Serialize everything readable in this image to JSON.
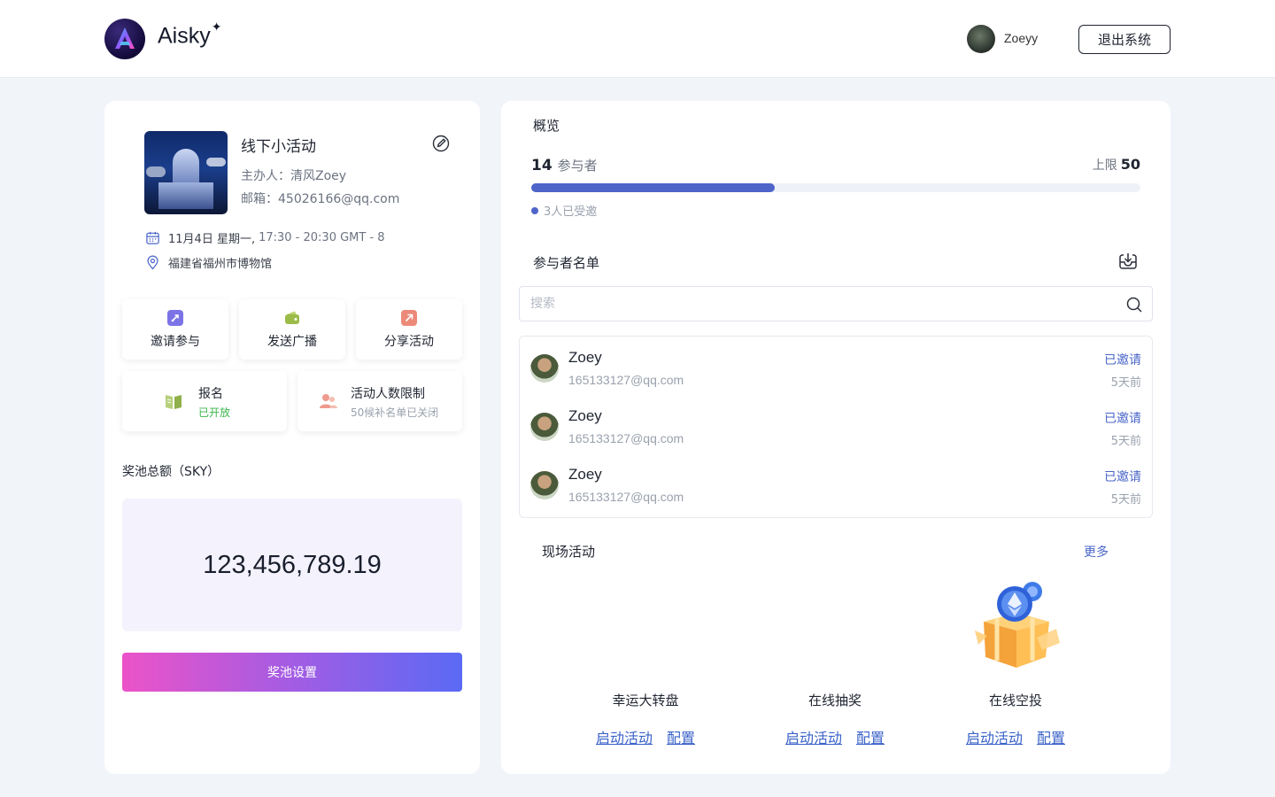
{
  "header": {
    "brand": "Aisky",
    "brand_mark": "✦",
    "user_name": "Zoeyy",
    "logout_label": "退出系统"
  },
  "event": {
    "title": "线下小活动",
    "host_label": "主办人：",
    "host": "清风Zoey",
    "email_label": "邮箱：",
    "email": "45026166@qq.com",
    "date": "11月4日  星期一,",
    "time": "17:30 - 20:30  GMT - 8",
    "location": "福建省福州市博物馆"
  },
  "actions": [
    {
      "label": "邀请参与",
      "icon": "invite-icon",
      "color": "#7b73e6"
    },
    {
      "label": "发送广播",
      "icon": "wallet-icon",
      "color": "#9cbc4a"
    },
    {
      "label": "分享活动",
      "icon": "share-arrow-icon",
      "color": "#ec8a7a"
    }
  ],
  "signup": {
    "title": "报名",
    "status": "已开放",
    "status_color": "#39b54a"
  },
  "limit_tile": {
    "title": "活动人数限制",
    "status": "50候补名单已关闭"
  },
  "pool": {
    "label": "奖池总额（SKY）",
    "value": "123,456,789.19",
    "button_label": "奖池设置"
  },
  "overview": {
    "title": "概览",
    "count": "14",
    "count_label": "参与者",
    "limit_label": "上限",
    "limit": "50",
    "progress": 0.4,
    "invited_note": "3人已受邀"
  },
  "attendees": {
    "title": "参与者名单",
    "search_placeholder": "搜索",
    "rows": [
      {
        "name": "Zoey",
        "email": "165133127@qq.com",
        "status": "已邀请",
        "time": "5天前"
      },
      {
        "name": "Zoey",
        "email": "165133127@qq.com",
        "status": "已邀请",
        "time": "5天前"
      },
      {
        "name": "Zoey",
        "email": "165133127@qq.com",
        "status": "已邀请",
        "time": "5天前"
      }
    ]
  },
  "activities": {
    "title": "现场活动",
    "more_label": "更多",
    "items": [
      {
        "name": "幸运大转盘",
        "start_label": "启动活动",
        "config_label": "配置"
      },
      {
        "name": "在线抽奖",
        "start_label": "启动活动",
        "config_label": "配置"
      },
      {
        "name": "在线空投",
        "start_label": "启动活动",
        "config_label": "配置"
      }
    ]
  },
  "colors": {
    "accent": "#4f64c8",
    "link": "#4a66c9"
  }
}
